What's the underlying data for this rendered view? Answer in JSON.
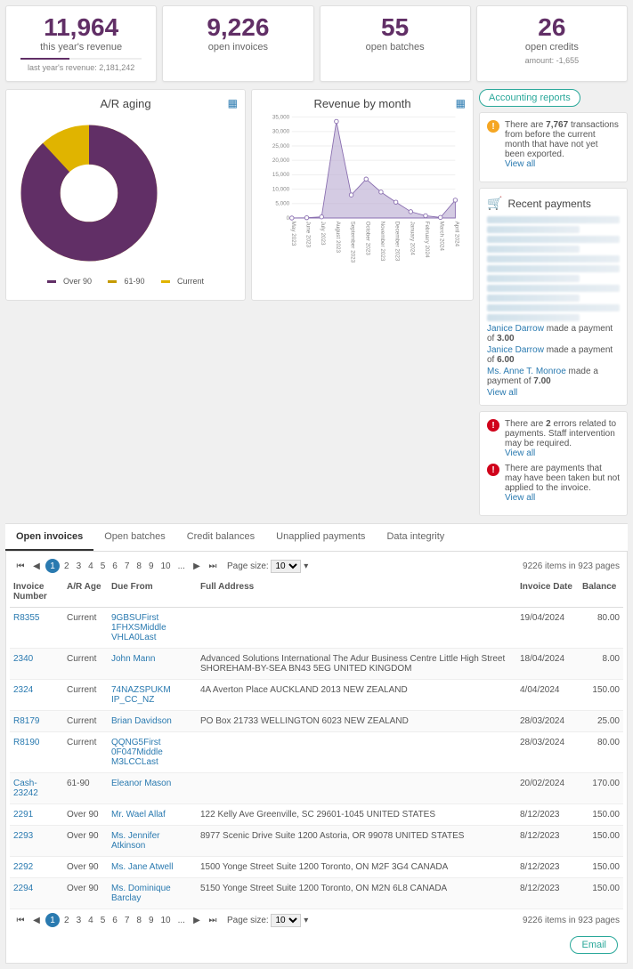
{
  "cards": [
    {
      "value": "11,964",
      "label": "this year's revenue",
      "sub": "last year's revenue: 2,181,242",
      "showBar": true
    },
    {
      "value": "9,226",
      "label": "open invoices"
    },
    {
      "value": "55",
      "label": "open batches"
    },
    {
      "value": "26",
      "label": "open credits",
      "sub": "amount: -1,655"
    }
  ],
  "ar_panel": {
    "title": "A/R aging"
  },
  "rev_panel": {
    "title": "Revenue by month"
  },
  "chart_data": [
    {
      "type": "donut",
      "title": "A/R aging",
      "series": [
        {
          "name": "Over 90",
          "value": 88,
          "color": "#612f66"
        },
        {
          "name": "61-90",
          "value": 2,
          "color": "#c49a00"
        },
        {
          "name": "Current",
          "value": 10,
          "color": "#e0b400"
        }
      ]
    },
    {
      "type": "area",
      "title": "Revenue by month",
      "ylabel": "",
      "ylim": [
        0,
        35000
      ],
      "yticks": [
        0,
        5000,
        10000,
        15000,
        20000,
        25000,
        30000,
        35000
      ],
      "categories": [
        "May 2023",
        "June 2023",
        "July 2023",
        "August 2023",
        "September 2023",
        "October 2023",
        "November 2023",
        "December 2023",
        "January 2024",
        "February 2024",
        "March 2024",
        "April 2024"
      ],
      "values": [
        0,
        100,
        400,
        33500,
        8000,
        13500,
        9000,
        5500,
        2200,
        800,
        200,
        6200
      ],
      "color": "#a08cc0"
    }
  ],
  "legend": {
    "over90": "Over 90",
    "r6190": "61-90",
    "current": "Current"
  },
  "colors": {
    "over90": "#612f66",
    "r6190": "#c49a00",
    "current": "#e0b400"
  },
  "reports_btn": "Accounting reports",
  "alerts": {
    "export": {
      "text_a": "There are ",
      "count": "7,767",
      "text_b": " transactions from before the current month that have not yet been exported."
    },
    "errors": {
      "text_a": "There are ",
      "count": "2",
      "text_b": " errors related to payments. Staff intervention may be required."
    },
    "unapplied": "There are payments that may have been taken but not applied to the invoice.",
    "view_all": "View all"
  },
  "recent": {
    "title": "Recent payments",
    "lines": [
      {
        "name": "Janice Darrow",
        "mid": " made a payment of ",
        "amt": "3.00"
      },
      {
        "name": "Janice Darrow",
        "mid": " made a payment of ",
        "amt": "6.00"
      },
      {
        "name": "Ms. Anne T. Monroe",
        "mid": " made a payment of ",
        "amt": "7.00"
      }
    ],
    "view_all": "View all"
  },
  "tabs": [
    "Open invoices",
    "Open batches",
    "Credit balances",
    "Unapplied payments",
    "Data integrity"
  ],
  "pager": {
    "pages": [
      "1",
      "2",
      "3",
      "4",
      "5",
      "6",
      "7",
      "8",
      "9",
      "10",
      "..."
    ],
    "size_label": "Page size:",
    "size_value": "10",
    "info": "9226 items in 923 pages"
  },
  "columns": [
    "Invoice Number",
    "A/R Age",
    "Due From",
    "Full Address",
    "Invoice Date",
    "Balance"
  ],
  "rows": [
    {
      "num": "R8355",
      "age": "Current",
      "due": "9GBSUFirst 1FHXSMiddle VHLA0Last",
      "addr": "",
      "date": "19/04/2024",
      "bal": "80.00"
    },
    {
      "num": "2340",
      "age": "Current",
      "due": "John Mann",
      "addr": "Advanced Solutions International The Adur Business Centre Little High Street SHOREHAM-BY-SEA BN43 5EG UNITED KINGDOM",
      "date": "18/04/2024",
      "bal": "8.00"
    },
    {
      "num": "2324",
      "age": "Current",
      "due": "74NAZSPUKM IP_CC_NZ",
      "addr": "4A Averton Place AUCKLAND 2013 NEW ZEALAND",
      "date": "4/04/2024",
      "bal": "150.00"
    },
    {
      "num": "R8179",
      "age": "Current",
      "due": "Brian Davidson",
      "addr": "PO Box 21733 WELLINGTON 6023 NEW ZEALAND",
      "date": "28/03/2024",
      "bal": "25.00"
    },
    {
      "num": "R8190",
      "age": "Current",
      "due": "QQNG5First 0F047Middle M3LCCLast",
      "addr": "",
      "date": "28/03/2024",
      "bal": "80.00"
    },
    {
      "num": "Cash-23242",
      "age": "61-90",
      "due": "Eleanor Mason",
      "addr": "",
      "date": "20/02/2024",
      "bal": "170.00"
    },
    {
      "num": "2291",
      "age": "Over 90",
      "due": "Mr. Wael Allaf",
      "addr": "122 Kelly Ave Greenville, SC 29601-1045 UNITED STATES",
      "date": "8/12/2023",
      "bal": "150.00"
    },
    {
      "num": "2293",
      "age": "Over 90",
      "due": "Ms. Jennifer Atkinson",
      "addr": "8977 Scenic Drive Suite 1200 Astoria, OR 99078 UNITED STATES",
      "date": "8/12/2023",
      "bal": "150.00"
    },
    {
      "num": "2292",
      "age": "Over 90",
      "due": "Ms. Jane Atwell",
      "addr": "1500 Yonge Street Suite 1200 Toronto, ON M2F 3G4 CANADA",
      "date": "8/12/2023",
      "bal": "150.00"
    },
    {
      "num": "2294",
      "age": "Over 90",
      "due": "Ms. Dominique Barclay",
      "addr": "5150 Yonge Street Suite 1200 Toronto, ON M2N 6L8 CANADA",
      "date": "8/12/2023",
      "bal": "150.00"
    }
  ],
  "email_btn": "Email"
}
